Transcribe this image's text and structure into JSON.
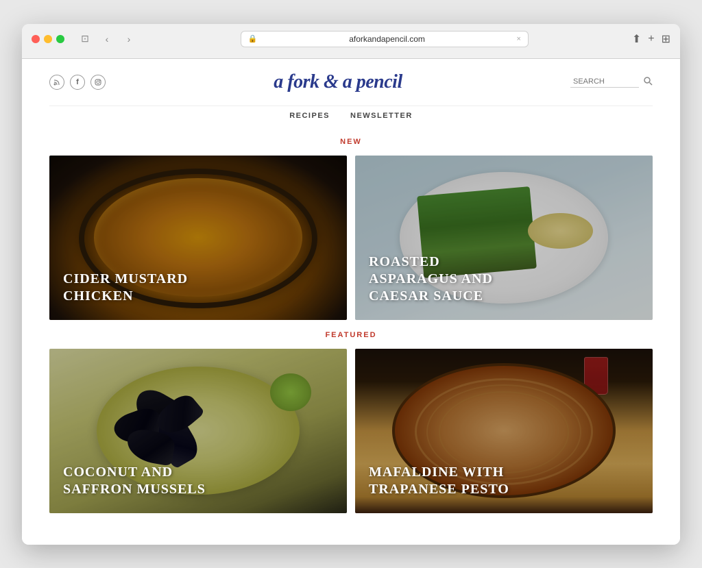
{
  "browser": {
    "url": "aforkandapencil.com",
    "tab_close": "×",
    "nav_back": "‹",
    "nav_forward": "›",
    "action_share": "⬆",
    "action_new_tab": "+",
    "action_grid": "⊞"
  },
  "site": {
    "title": "a fork & a pencil",
    "social": {
      "icons": [
        "○",
        "f",
        "○"
      ]
    },
    "search_placeholder": "SEARCH",
    "nav_items": [
      "RECIPES",
      "NEWSLETTER"
    ],
    "sections": [
      {
        "label": "NEW",
        "cards": [
          {
            "id": "cider-chicken",
            "title": "CIDER MUSTARD\nCHICKEN"
          },
          {
            "id": "asparagus",
            "title": "ROASTED\nASPARAGUS AND\nCAESAR SAUCE"
          }
        ]
      },
      {
        "label": "FEATURED",
        "cards": [
          {
            "id": "mussels",
            "title": "COCONUT AND\nSAFFRON MUSSELS"
          },
          {
            "id": "pasta",
            "title": "MAFALDINE WITH\nTRAPANESE PESTO"
          }
        ]
      }
    ]
  }
}
